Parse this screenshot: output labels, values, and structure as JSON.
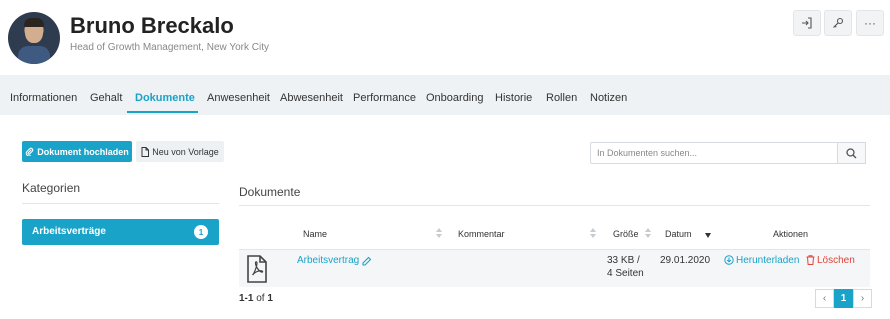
{
  "profile": {
    "name": "Bruno Breckalo",
    "subtitle": "Head of Growth Management, New York City"
  },
  "header_actions": {
    "login_icon": "sign-in-icon",
    "key_icon": "key-icon",
    "more_label": "···"
  },
  "tabs": [
    {
      "label": "Informationen"
    },
    {
      "label": "Gehalt"
    },
    {
      "label": "Dokumente",
      "active": true
    },
    {
      "label": "Anwesenheit"
    },
    {
      "label": "Abwesenheit"
    },
    {
      "label": "Performance"
    },
    {
      "label": "Onboarding"
    },
    {
      "label": "Historie"
    },
    {
      "label": "Rollen"
    },
    {
      "label": "Notizen"
    }
  ],
  "toolbar": {
    "upload_label": "Dokument hochladen",
    "template_label": "Neu von Vorlage",
    "search_placeholder": "In Dokumenten suchen..."
  },
  "categories": {
    "title": "Kategorien",
    "items": [
      {
        "label": "Arbeitsverträge",
        "count": "1"
      }
    ]
  },
  "documents": {
    "title": "Dokumente",
    "columns": {
      "name": "Name",
      "comment": "Kommentar",
      "size": "Größe",
      "date": "Datum",
      "actions": "Aktionen"
    },
    "rows": [
      {
        "name": "Arbeitsvertrag",
        "comment": "",
        "size_line1": "33 KB /",
        "size_line2": "4 Seiten",
        "date": "29.01.2020",
        "download_label": "Herunterladen",
        "delete_label": "Löschen"
      }
    ],
    "pagination": {
      "range": "1-1",
      "of": "of",
      "total": "1",
      "current_page": "1",
      "prev": "‹",
      "next": "›"
    }
  },
  "colors": {
    "accent": "#1aa3c8",
    "danger": "#e0453a",
    "tabbar_bg": "#eef2f5"
  }
}
